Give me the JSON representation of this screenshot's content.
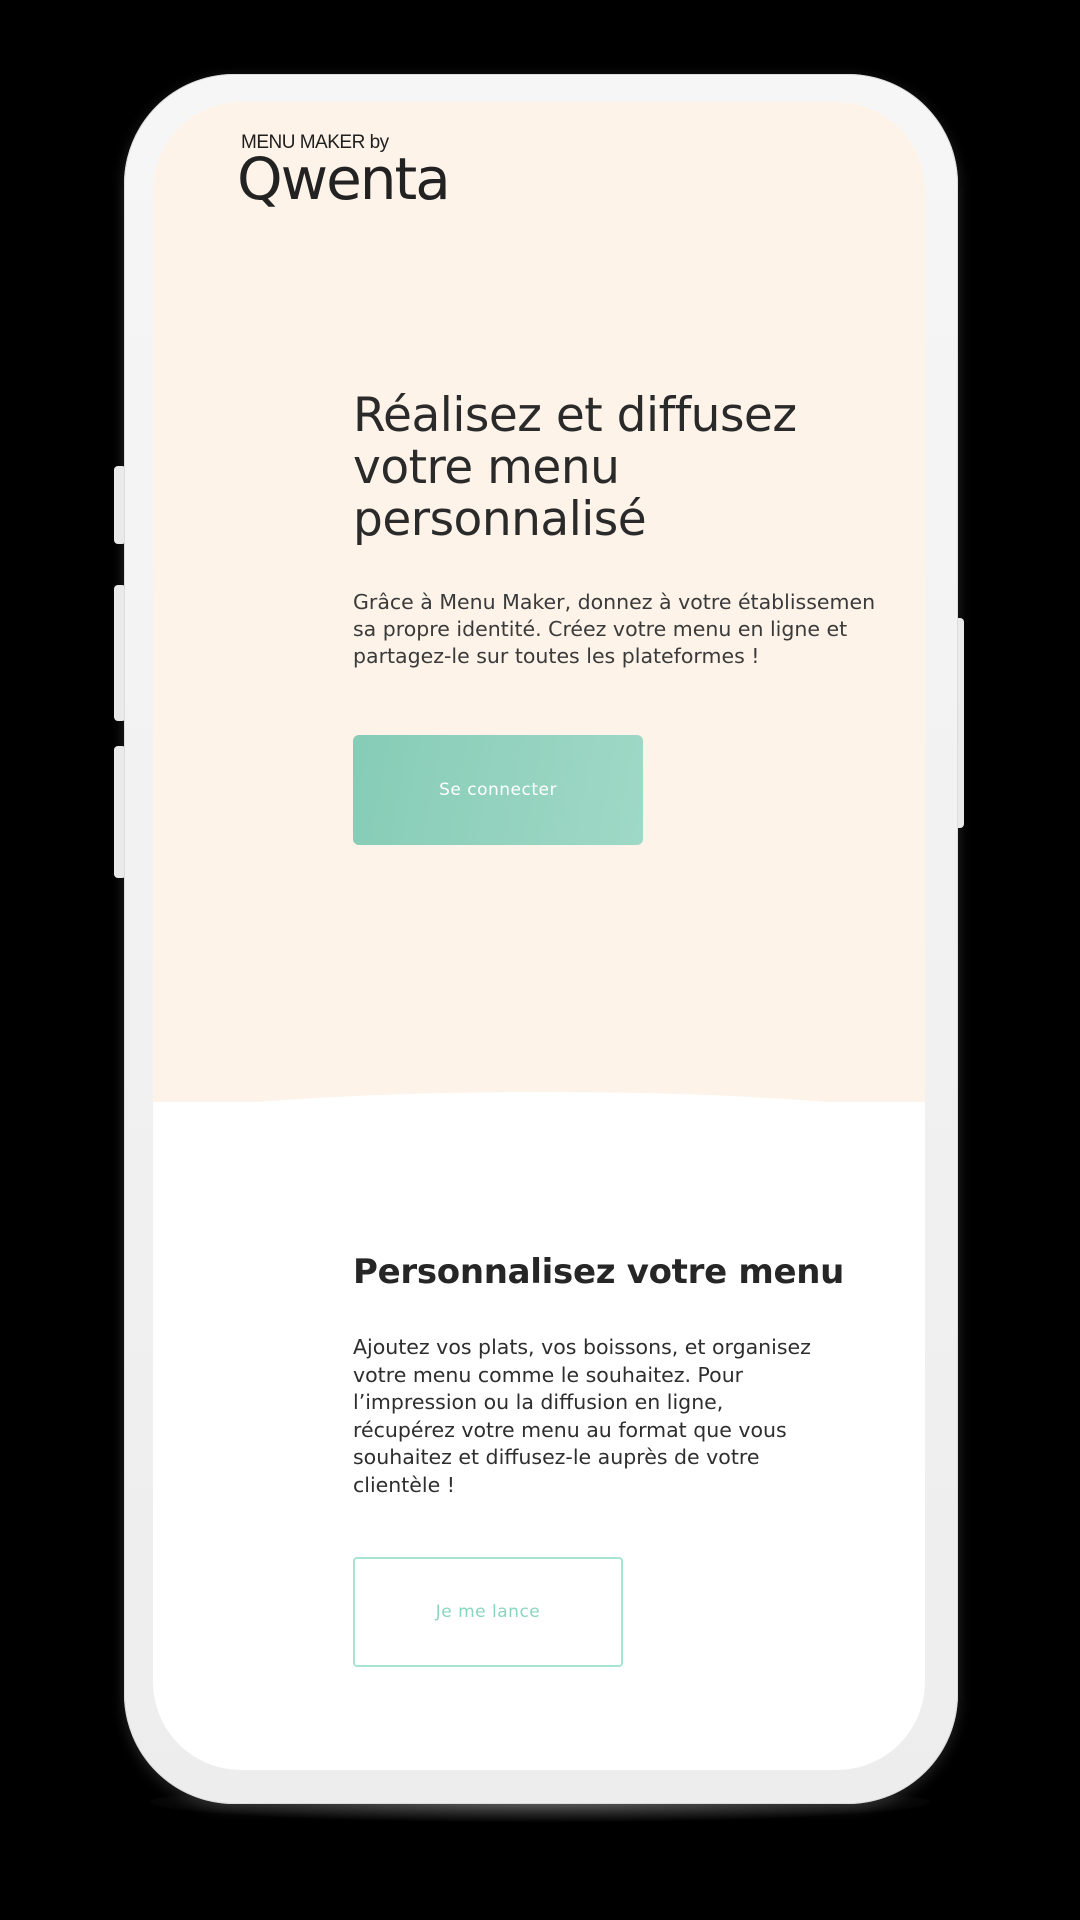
{
  "logo": {
    "small": "MENU MAKER by",
    "brand": "Qwenta"
  },
  "hero": {
    "title": "Réalisez et diffusez votre menu personnalisé",
    "description_lines": [
      "Grâce à Menu Maker, donnez à votre établissemen",
      "sa propre identité. Créez votre menu en ligne et",
      "partagez-le sur toutes les plateformes !"
    ],
    "cta_label": "Se connecter"
  },
  "section": {
    "title": "Personnalisez votre menu",
    "description_lines": [
      "Ajoutez vos plats, vos boissons, et organisez",
      "votre menu comme le souhaitez. Pour",
      "l’impression ou la diffusion en ligne,",
      "récupérez votre menu au format que vous",
      "souhaitez et diffusez-le auprès de votre",
      "clientèle !"
    ],
    "cta_label": "Je me lance"
  },
  "colors": {
    "hero_background": "#fdf3e9",
    "primary_button": "#93d2be",
    "outline_accent": "#a8e4d2",
    "text_dark": "#2a2a2a"
  }
}
